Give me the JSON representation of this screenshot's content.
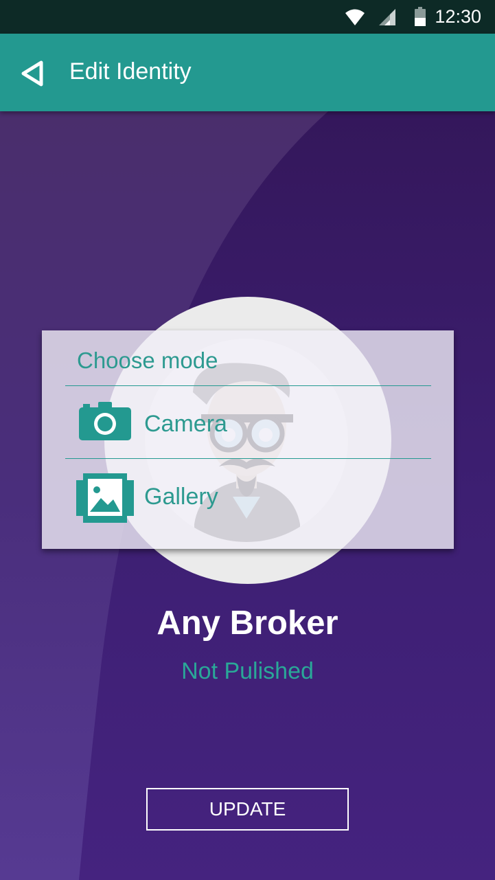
{
  "status_bar": {
    "time": "12:30",
    "icons": [
      "wifi-icon",
      "signal-icon",
      "battery-icon"
    ]
  },
  "app_bar": {
    "back_icon": "back-arrow-icon",
    "title": "Edit Identity",
    "color": "#239990"
  },
  "dialog": {
    "title": "Choose mode",
    "options": [
      {
        "label": "Camera",
        "icon": "camera-icon"
      },
      {
        "label": "Gallery",
        "icon": "gallery-icon"
      }
    ]
  },
  "profile": {
    "name": "Any Broker",
    "status": "Not Pulished"
  },
  "update_button": {
    "label": "UPDATE"
  },
  "colors": {
    "accent": "#239990",
    "background": "#3a1f6a",
    "text_on_dark": "#ffffff"
  }
}
